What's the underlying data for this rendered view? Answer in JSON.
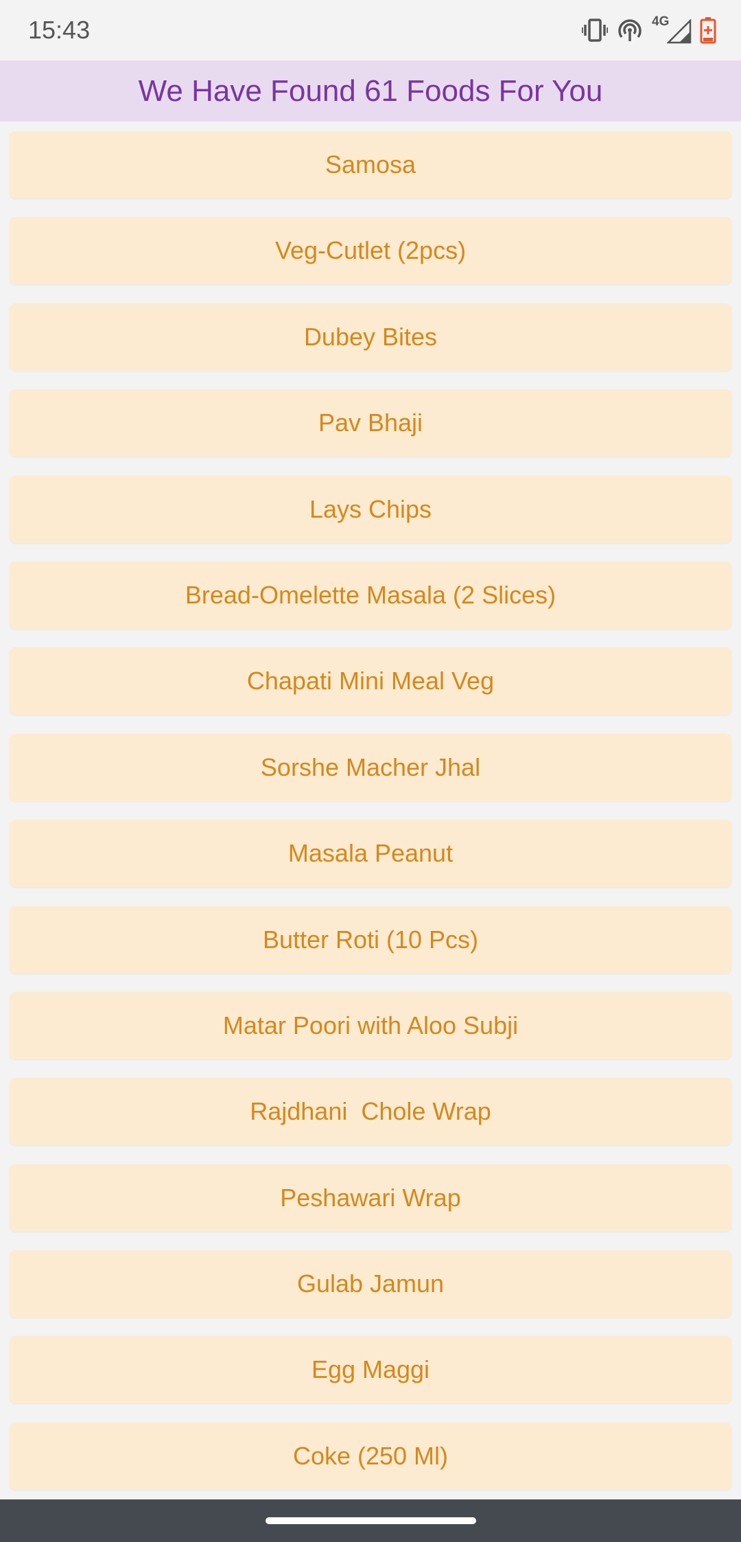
{
  "status_bar": {
    "time": "15:43",
    "network_label": "4G",
    "icons": [
      "vibrate-icon",
      "hotspot-icon",
      "signal-icon",
      "battery-icon"
    ],
    "battery_color": "#e8552e"
  },
  "header": {
    "title": "We Have Found 61 Foods For You",
    "background": "#e8dbf0",
    "text_color": "#7a35a0"
  },
  "food_list": {
    "item_background": "#fdebd1",
    "item_text_color": "#d4881c",
    "items": [
      "Samosa",
      "Veg-Cutlet (2pcs)",
      "Dubey Bites",
      "Pav Bhaji",
      "Lays Chips",
      "Bread-Omelette Masala (2 Slices)",
      "Chapati Mini Meal Veg",
      "Sorshe Macher Jhal",
      "Masala Peanut",
      "Butter Roti (10 Pcs)",
      "Matar Poori with Aloo Subji",
      "Rajdhani  Chole Wrap",
      "Peshawari Wrap",
      "Gulab Jamun",
      "Egg Maggi",
      "Coke (250 Ml)"
    ]
  }
}
